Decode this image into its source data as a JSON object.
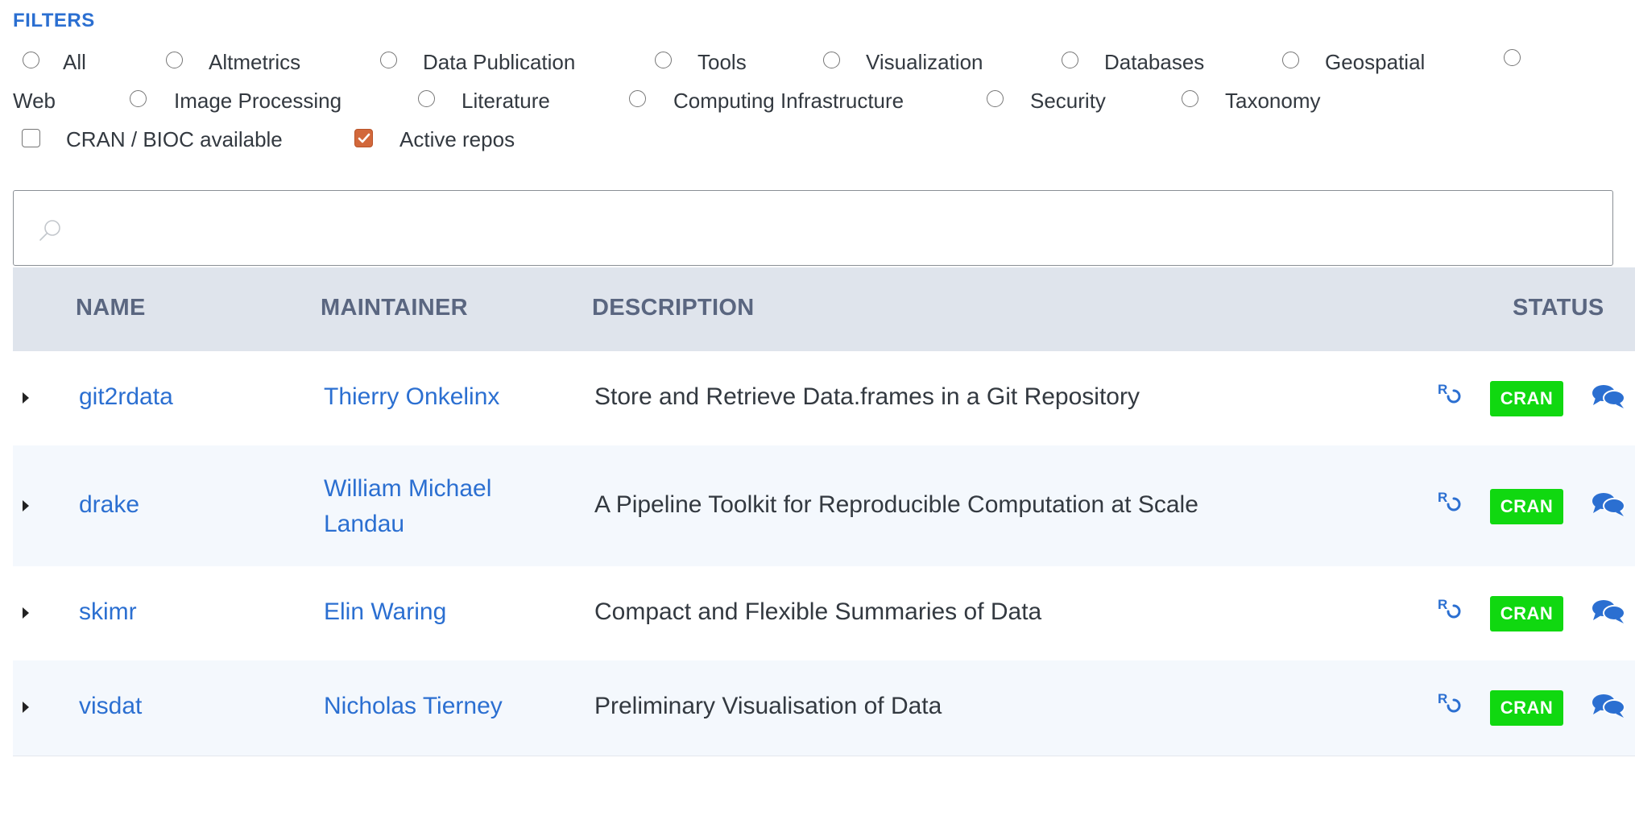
{
  "filters": {
    "title": "FILTERS",
    "radios": [
      "All",
      "Altmetrics",
      "Data Publication",
      "Tools",
      "Visualization",
      "Databases",
      "Geospatial",
      "Web",
      "Image Processing",
      "Literature",
      "Computing Infrastructure",
      "Security",
      "Taxonomy"
    ],
    "checkboxes": [
      {
        "label": "CRAN / BIOC available",
        "checked": false
      },
      {
        "label": "Active repos",
        "checked": true
      }
    ]
  },
  "search": {
    "value": "",
    "placeholder": ""
  },
  "table": {
    "headers": {
      "name": "NAME",
      "maintainer": "MAINTAINER",
      "description": "DESCRIPTION",
      "status": "STATUS"
    },
    "rows": [
      {
        "name": "git2rdata",
        "maintainer": "Thierry Onkelinx",
        "maintainer_lines": [
          "Thierry Onkelinx"
        ],
        "description": "Store and Retrieve Data.frames in a Git Repository",
        "badge": "CRAN"
      },
      {
        "name": "drake",
        "maintainer": "William Michael Landau",
        "maintainer_lines": [
          "William Michael",
          "Landau"
        ],
        "description": "A Pipeline Toolkit for Reproducible Computation at Scale",
        "badge": "CRAN"
      },
      {
        "name": "skimr",
        "maintainer": "Elin Waring",
        "maintainer_lines": [
          "Elin Waring"
        ],
        "description": "Compact and Flexible Summaries of Data",
        "badge": "CRAN"
      },
      {
        "name": "visdat",
        "maintainer": "Nicholas Tierney",
        "maintainer_lines": [
          "Nicholas Tierney"
        ],
        "description": "Preliminary Visualisation of Data",
        "badge": "CRAN"
      }
    ]
  },
  "icons": {
    "search": "search-icon",
    "row_expand": "caret-right-icon",
    "ropensci": "ropensci-ro-icon",
    "discussion": "comments-icon"
  },
  "colors": {
    "link": "#2b6fd1",
    "badge": "#10d810",
    "header_bg": "#dfe4ec",
    "checkbox_accent": "#d2683b",
    "alt_row": "#f4f8fd"
  }
}
